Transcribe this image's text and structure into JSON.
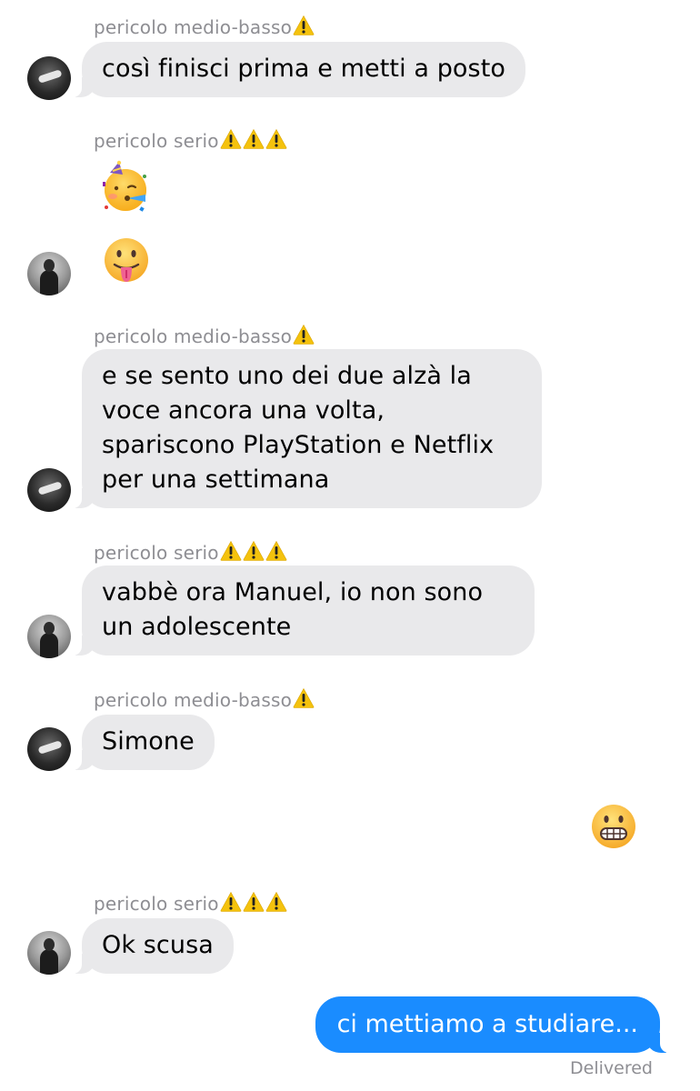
{
  "thread": {
    "senders": {
      "a": "pericolo medio-basso",
      "b": "pericolo serio"
    },
    "messages": [
      {
        "sender": "a",
        "text": "così finisci prima e metti a posto"
      },
      {
        "sender": "b",
        "emoji": "partying-face"
      },
      {
        "sender": "b",
        "emoji": "face-with-tongue"
      },
      {
        "sender": "a",
        "text": "e se sento uno dei due alzà la voce ancora una volta, spariscono PlayStation e Netflix per una settimana"
      },
      {
        "sender": "b",
        "text": "vabbè ora Manuel, io non sono un adolescente"
      },
      {
        "sender": "a",
        "text": "Simone"
      },
      {
        "sender": "me",
        "emoji": "grimacing-face"
      },
      {
        "sender": "b",
        "text": "Ok scusa"
      },
      {
        "sender": "me",
        "text": "ci mettiamo a studiare..."
      }
    ],
    "status": "Delivered"
  },
  "warning_icon": "warning-sign",
  "colors": {
    "incoming_bubble": "#e9e9eb",
    "outgoing_bubble": "#1a8cff",
    "sender_label": "#8e8e93",
    "warning": "#f4c20d"
  }
}
